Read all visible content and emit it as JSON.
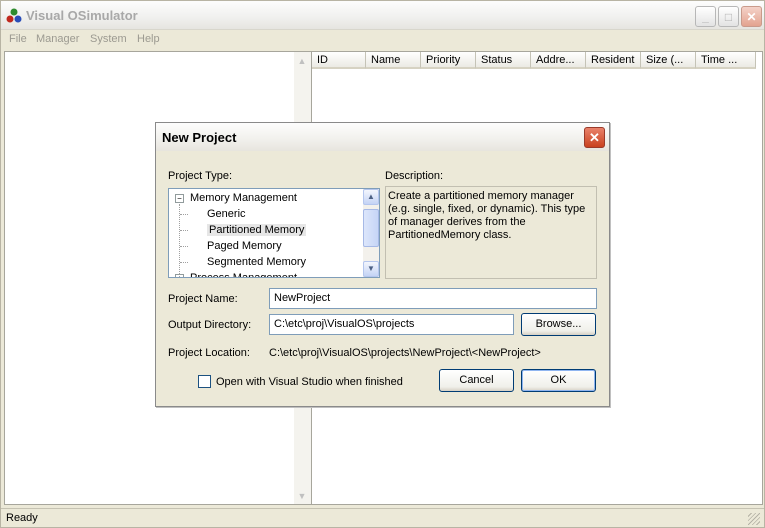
{
  "window": {
    "title": "Visual OSimulator",
    "buttons": {
      "minimize": "_",
      "maximize": "□",
      "close": "✕"
    }
  },
  "menu": [
    "File",
    "Manager",
    "System",
    "Help"
  ],
  "list": {
    "columns": [
      "ID",
      "Name",
      "Priority",
      "Status",
      "Addre...",
      "Resident",
      "Size (...",
      "Time ..."
    ]
  },
  "status": {
    "text": "Ready"
  },
  "dialog": {
    "title": "New Project",
    "close_glyph": "✕",
    "project_type_label": "Project Type:",
    "description_label": "Description:",
    "tree": [
      {
        "label": "Memory Management",
        "expander": "−"
      },
      {
        "label": "Generic"
      },
      {
        "label": "Partitioned Memory"
      },
      {
        "label": "Paged Memory"
      },
      {
        "label": "Segmented Memory"
      },
      {
        "label": "Process Management",
        "expander": "+"
      }
    ],
    "description": "Create a partitioned memory manager (e.g. single, fixed, or dynamic). This type of manager derives from the PartitionedMemory class.",
    "project_name_label": "Project Name:",
    "project_name_value": "NewProject",
    "output_dir_label": "Output Directory:",
    "output_dir_value": "C:\\etc\\proj\\VisualOS\\projects",
    "browse_label": "Browse...",
    "location_label": "Project Location:",
    "location_value": "C:\\etc\\proj\\VisualOS\\projects\\NewProject\\<NewProject>",
    "open_vs_label": "Open with Visual Studio when finished",
    "cancel_label": "Cancel",
    "ok_label": "OK"
  }
}
